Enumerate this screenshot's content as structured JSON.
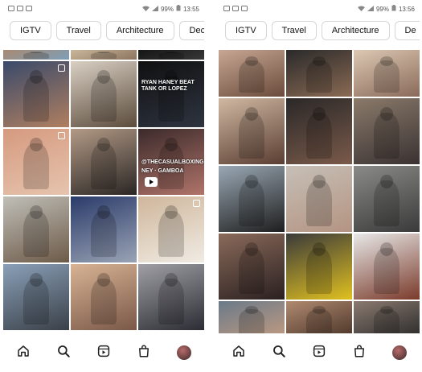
{
  "screens": [
    {
      "status": {
        "battery": "99%",
        "time": "13:55"
      },
      "chips": [
        "IGTV",
        "Travel",
        "Architecture",
        "Dec"
      ],
      "tiles": [
        {
          "colors": [
            "#a88a72",
            "#7e9eb8"
          ]
        },
        {
          "colors": [
            "#c9b79a",
            "#8d7460"
          ]
        },
        {
          "colors": [
            "#151515",
            "#383838"
          ]
        },
        {
          "colors": [
            "#3a4a6a",
            "#b07f60"
          ],
          "badge": true
        },
        {
          "colors": [
            "#d9d0c4",
            "#5b4b3b"
          ]
        },
        {
          "colors": [
            "#101010",
            "#2e3440"
          ],
          "overlay": "Ryan Haney beat Tank or Lopez"
        },
        {
          "colors": [
            "#d59a7f",
            "#e6c4ae"
          ],
          "badge": true
        },
        {
          "colors": [
            "#b39a86",
            "#2a2624"
          ]
        },
        {
          "colors": [
            "#3b2a2a",
            "#b0746a"
          ],
          "overlay": "@thecasualboxingnews",
          "overlay2": "ney · Gamboa",
          "play": true
        },
        {
          "colors": [
            "#c0bfb8",
            "#6d5a48"
          ]
        },
        {
          "colors": [
            "#2a3b6a",
            "#9aa3b5"
          ]
        },
        {
          "colors": [
            "#cfb69a",
            "#f0ebe4"
          ],
          "badge": true
        },
        {
          "colors": [
            "#8aa0b8",
            "#3a4048"
          ]
        },
        {
          "colors": [
            "#d8b394",
            "#7a5848"
          ]
        },
        {
          "colors": [
            "#9f9fa5",
            "#2c2c34"
          ]
        }
      ],
      "nav": [
        "home-icon",
        "search-icon",
        "reels-icon",
        "shop-icon",
        "profile-avatar"
      ]
    },
    {
      "status": {
        "battery": "99%",
        "time": "13:56"
      },
      "chips": [
        "IGTV",
        "Travel",
        "Architecture",
        "De"
      ],
      "tiles": [
        {
          "colors": [
            "#c8a894",
            "#6a4a3a"
          ]
        },
        {
          "colors": [
            "#2a2a2a",
            "#8a6a54"
          ]
        },
        {
          "colors": [
            "#dcc8b2",
            "#8a6a5a"
          ]
        },
        {
          "colors": [
            "#d0b8a2",
            "#5a3e32"
          ]
        },
        {
          "colors": [
            "#2a2828",
            "#7a5a4a"
          ]
        },
        {
          "colors": [
            "#8a7a6a",
            "#3a3232"
          ]
        },
        {
          "colors": [
            "#9aa8b4",
            "#1e1e1e"
          ]
        },
        {
          "colors": [
            "#c6bfb6",
            "#b49482"
          ]
        },
        {
          "colors": [
            "#8a8a88",
            "#3a3a3a"
          ]
        },
        {
          "colors": [
            "#8a6a5a",
            "#2a2020"
          ]
        },
        {
          "colors": [
            "#3a3a3a",
            "#e0c020"
          ]
        },
        {
          "colors": [
            "#e8e8e8",
            "#7a3a2a"
          ]
        },
        {
          "colors": [
            "#6a7a8a",
            "#c09a80"
          ]
        },
        {
          "colors": [
            "#b08a70",
            "#4a3428"
          ]
        },
        {
          "colors": [
            "#8a7a70",
            "#2a2a2a"
          ]
        }
      ],
      "nav": [
        "home-icon",
        "search-icon",
        "reels-icon",
        "shop-icon",
        "profile-avatar"
      ]
    }
  ]
}
